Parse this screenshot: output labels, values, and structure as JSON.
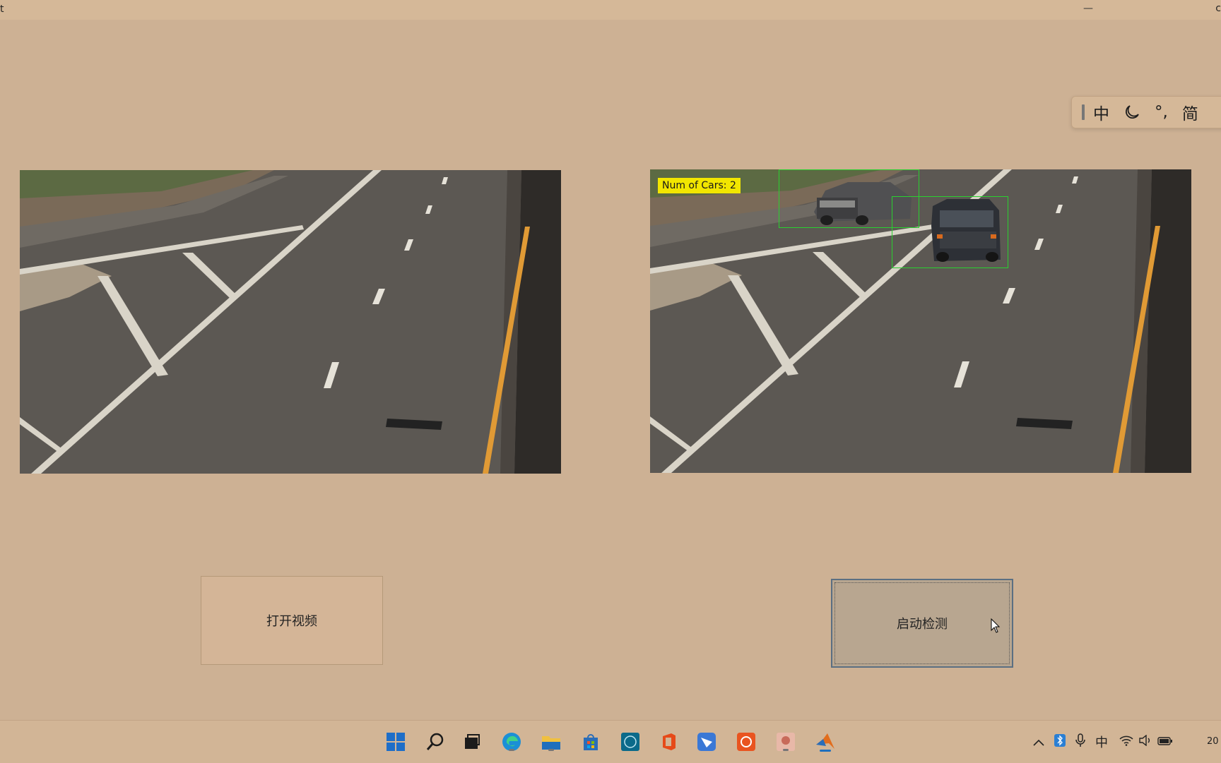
{
  "window": {
    "title_fragment": "t",
    "minimize_glyph": "—",
    "close_fragment": "c"
  },
  "ime_toolbar": {
    "items": [
      {
        "name": "chinese-mode",
        "text": "中"
      },
      {
        "name": "moon",
        "text": ""
      },
      {
        "name": "punctuation",
        "text": "°,"
      },
      {
        "name": "simplified",
        "text": "简"
      }
    ]
  },
  "videos": {
    "left": {
      "description_icon": "road-frame"
    },
    "right": {
      "count_label": "Num of Cars: 2",
      "box_color": "#29d12f",
      "label_color": "#f2e600"
    }
  },
  "buttons": {
    "open_video": "打开视频",
    "start_detection": "启动检测"
  },
  "taskbar": {
    "apps": [
      "windows-start-icon",
      "search-icon",
      "task-view-icon",
      "edge-icon",
      "file-explorer-icon",
      "store-icon",
      "dell-icon",
      "office-icon",
      "feishu-icon",
      "ubuntu-icon",
      "image-app-icon",
      "matlab-icon"
    ],
    "tray": {
      "ime": "中",
      "clock_fragment": "20"
    }
  },
  "colors": {
    "background": "#cdb194",
    "button_active_border": "#5b6f82",
    "taskbar_active": "#1f6fbd"
  }
}
